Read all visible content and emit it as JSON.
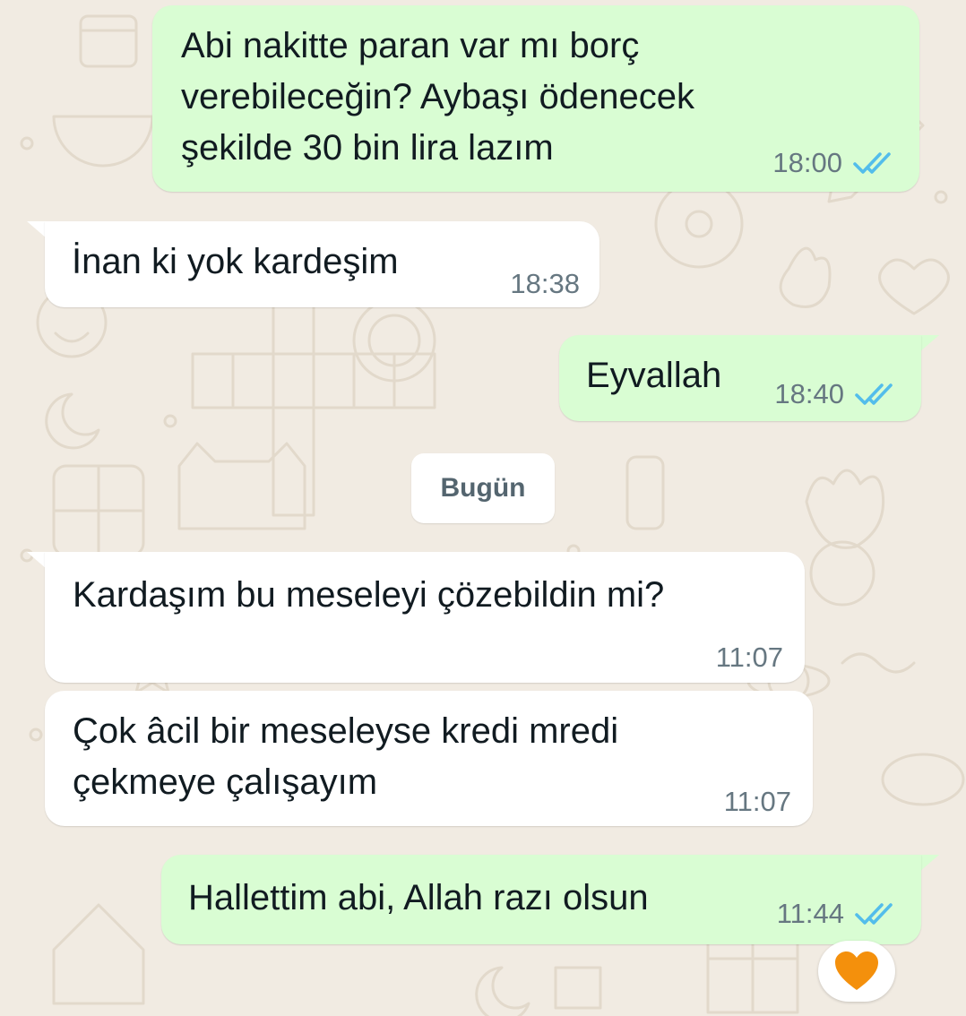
{
  "chat": {
    "date_divider": "Bugün",
    "messages": [
      {
        "direction": "outgoing",
        "lines": [
          "Abi nakitte paran var mı borç",
          "verebileceğin? Aybaşı ödenecek",
          "şekilde 30 bin lira lazım"
        ],
        "time": "18:00",
        "status": "read"
      },
      {
        "direction": "incoming",
        "lines": [
          "İnan ki yok kardeşim"
        ],
        "time": "18:38"
      },
      {
        "direction": "outgoing",
        "lines": [
          "Eyvallah"
        ],
        "time": "18:40",
        "status": "read"
      },
      {
        "direction": "incoming",
        "lines": [
          "Kardaşım bu meseleyi çözebildin mi?"
        ],
        "time": "11:07"
      },
      {
        "direction": "incoming",
        "lines": [
          "Çok âcil bir meseleyse kredi mredi",
          "çekmeye çalışayım"
        ],
        "time": "11:07"
      },
      {
        "direction": "outgoing",
        "lines": [
          "Hallettim abi, Allah razı olsun"
        ],
        "time": "11:44",
        "status": "read",
        "reaction": "orange-heart-emoji"
      }
    ]
  },
  "icons": {
    "read_receipt": "double-check-icon",
    "reaction": "orange-heart-icon"
  },
  "colors": {
    "outgoing_bubble": "#d9fdd3",
    "incoming_bubble": "#ffffff",
    "chat_background": "#f1ebe2",
    "read_ticks": "#53bdeb",
    "reaction_heart": "#f4900c"
  }
}
